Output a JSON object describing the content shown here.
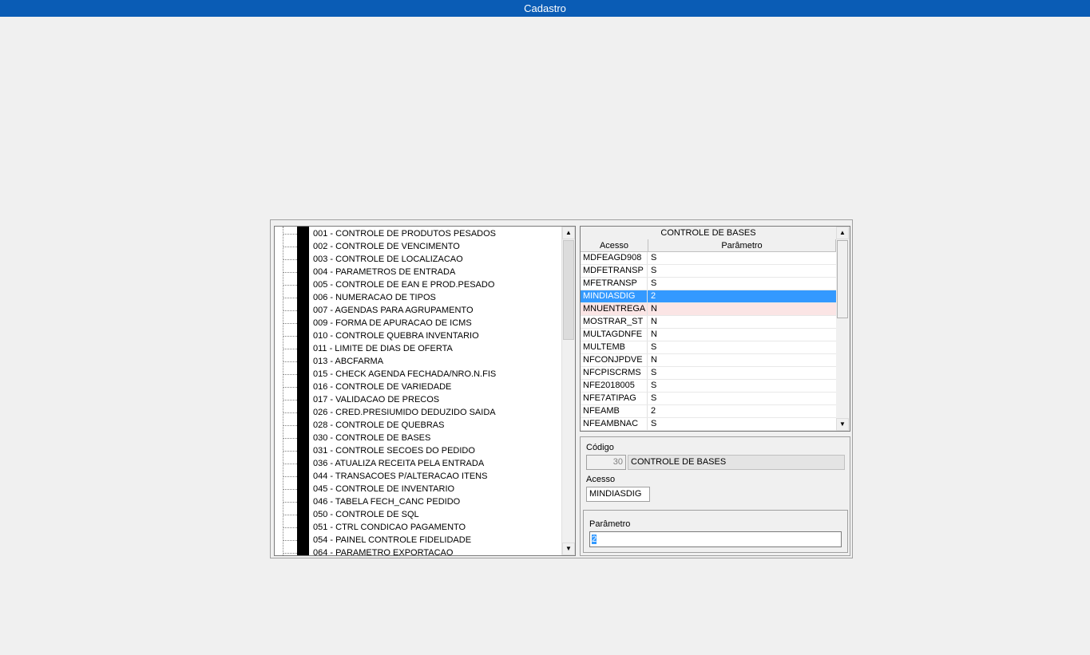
{
  "window": {
    "title": "Cadastro"
  },
  "tree": {
    "items": [
      "001 - CONTROLE DE PRODUTOS PESADOS",
      "002 - CONTROLE DE VENCIMENTO",
      "003 - CONTROLE DE LOCALIZACAO",
      "004 - PARAMETROS DE ENTRADA",
      "005 - CONTROLE DE EAN E PROD.PESADO",
      "006 - NUMERACAO DE TIPOS",
      "007 - AGENDAS PARA AGRUPAMENTO",
      "009 - FORMA DE APURACAO DE ICMS",
      "010 - CONTROLE QUEBRA INVENTARIO",
      "011 - LIMITE DE DIAS DE OFERTA",
      "013 - ABCFARMA",
      "015 - CHECK AGENDA FECHADA/NRO.N.FIS",
      "016 - CONTROLE DE VARIEDADE",
      "017 - VALIDACAO DE PRECOS",
      "026 - CRED.PRESIUMIDO DEDUZIDO SAIDA",
      "028 - CONTROLE DE QUEBRAS",
      "030 - CONTROLE DE BASES",
      "031 - CONTROLE SECOES DO PEDIDO",
      "036 - ATUALIZA RECEITA PELA ENTRADA",
      "044 - TRANSACOES P/ALTERACAO ITENS",
      "045 - CONTROLE DE INVENTARIO",
      "046 - TABELA FECH_CANC PEDIDO",
      "050 - CONTROLE DE SQL",
      "051 - CTRL CONDICAO PAGAMENTO",
      "054 - PAINEL CONTROLE FIDELIDADE",
      "064 - PARAMETRO EXPORTACAO"
    ],
    "scroll_up": "▲",
    "scroll_down": "▼"
  },
  "grid": {
    "title": "CONTROLE DE BASES",
    "columns": [
      "Acesso",
      "Parâmetro"
    ],
    "rows": [
      {
        "acesso": "MDFEAGD908",
        "parametro": "S"
      },
      {
        "acesso": "MDFETRANSP",
        "parametro": "S"
      },
      {
        "acesso": "MFETRANSP",
        "parametro": "S"
      },
      {
        "acesso": "MINDIASDIG",
        "parametro": "2"
      },
      {
        "acesso": "MNUENTREGA",
        "parametro": "N"
      },
      {
        "acesso": "MOSTRAR_ST",
        "parametro": "N"
      },
      {
        "acesso": "MULTAGDNFE",
        "parametro": "N"
      },
      {
        "acesso": "MULTEMB",
        "parametro": "S"
      },
      {
        "acesso": "NFCONJPDVE",
        "parametro": "N"
      },
      {
        "acesso": "NFCPISCRMS",
        "parametro": "S"
      },
      {
        "acesso": "NFE2018005",
        "parametro": "S"
      },
      {
        "acesso": "NFE7ATIPAG",
        "parametro": "S"
      },
      {
        "acesso": "NFEAMB",
        "parametro": "2"
      },
      {
        "acesso": "NFEAMBNAC",
        "parametro": "S"
      }
    ],
    "selected_index": 3,
    "highlight_index": 4,
    "scroll_up": "▲",
    "scroll_down": "▼"
  },
  "form": {
    "codigo_label": "Código",
    "codigo_value": "30",
    "codigo_desc": "CONTROLE DE BASES",
    "acesso_label": "Acesso",
    "acesso_value": "MINDIASDIG",
    "parametro_label": "Parâmetro",
    "parametro_value": "2"
  }
}
